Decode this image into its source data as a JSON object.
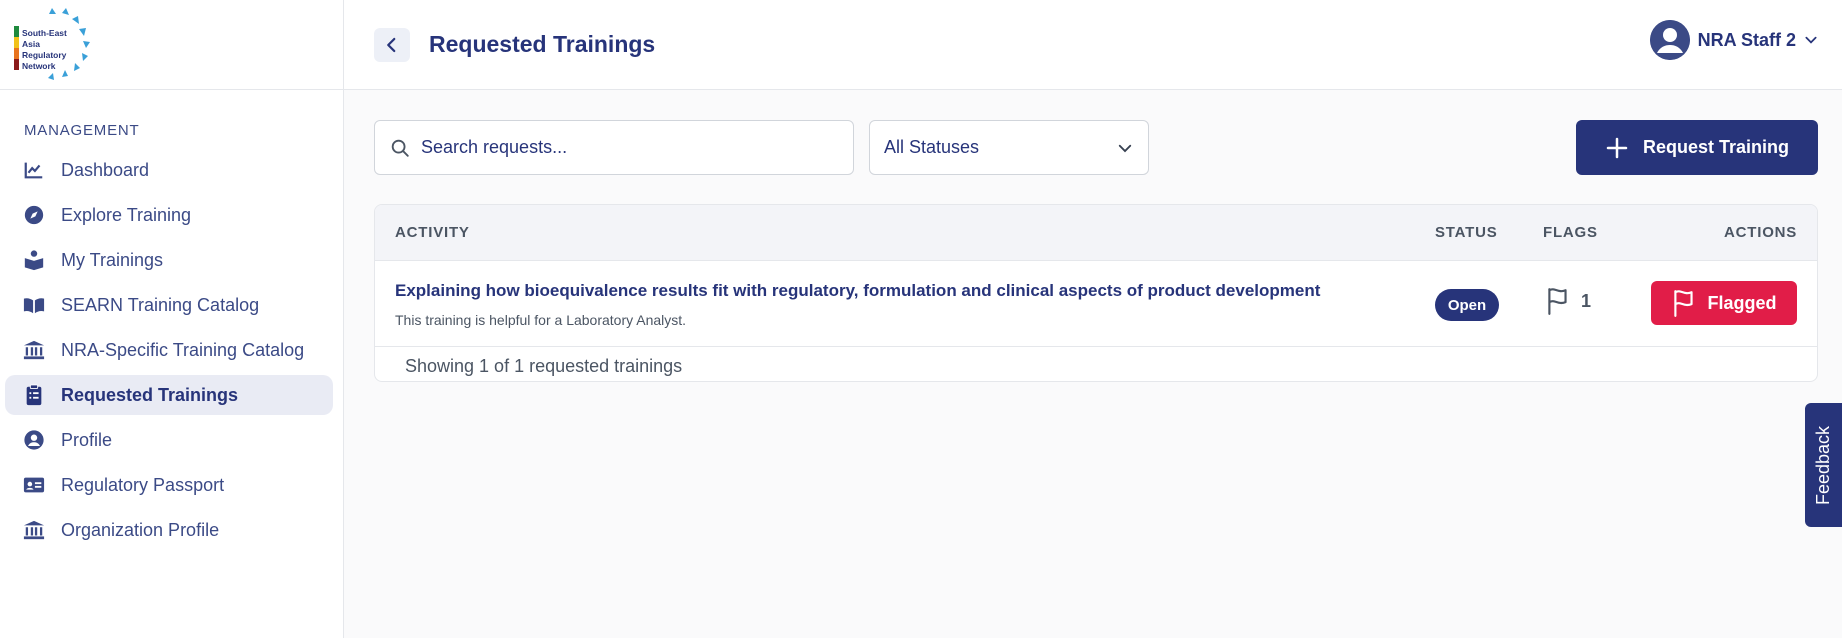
{
  "app": {
    "logo_lines": [
      "South-East",
      "Asia",
      "Regulatory",
      "Network"
    ],
    "brand_color": "#27347a",
    "danger_color": "#e11d48"
  },
  "sidebar": {
    "section_label": "MANAGEMENT",
    "items": [
      {
        "label": "Dashboard",
        "icon": "chart-line-icon",
        "active": false
      },
      {
        "label": "Explore Training",
        "icon": "compass-icon",
        "active": false
      },
      {
        "label": "My Trainings",
        "icon": "reader-icon",
        "active": false
      },
      {
        "label": "SEARN Training Catalog",
        "icon": "open-book-icon",
        "active": false
      },
      {
        "label": "NRA-Specific Training Catalog",
        "icon": "institution-icon",
        "active": false
      },
      {
        "label": "Requested Trainings",
        "icon": "clipboard-icon",
        "active": true
      },
      {
        "label": "Profile",
        "icon": "user-circle-icon",
        "active": false
      },
      {
        "label": "Regulatory Passport",
        "icon": "id-card-icon",
        "active": false
      },
      {
        "label": "Organization Profile",
        "icon": "institution-icon",
        "active": false
      }
    ]
  },
  "header": {
    "title": "Requested Trainings",
    "user_name": "NRA Staff 2"
  },
  "toolbar": {
    "search_placeholder": "Search requests...",
    "status_filter": "All Statuses",
    "request_button": "Request Training"
  },
  "table": {
    "columns": {
      "activity": "ACTIVITY",
      "status": "STATUS",
      "flags": "FLAGS",
      "actions": "ACTIONS"
    },
    "rows": [
      {
        "title": "Explaining how bioequivalence results fit with regulatory, formulation and clinical aspects of product development",
        "description": "This training is helpful for a Laboratory Analyst.",
        "status": "Open",
        "flags": "1",
        "action": "Flagged"
      }
    ],
    "footer": "Showing 1 of 1 requested trainings"
  },
  "feedback_label": "Feedback"
}
